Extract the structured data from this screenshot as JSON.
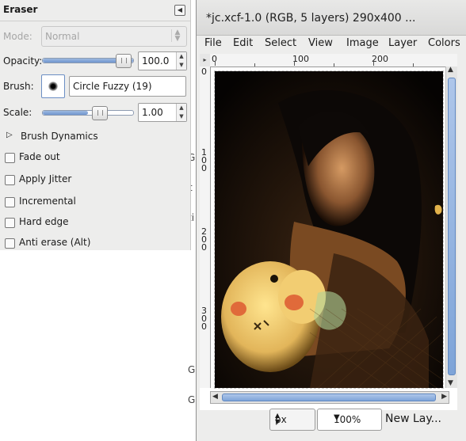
{
  "tool_options": {
    "title": "Eraser",
    "mode": {
      "label": "Mode:",
      "value": "Normal"
    },
    "opacity": {
      "label": "Opacity:",
      "value": "100.0",
      "fraction": 1.0
    },
    "brush": {
      "label": "Brush:",
      "name": "Circle Fuzzy (19)"
    },
    "scale": {
      "label": "Scale:",
      "value": "1.00",
      "fraction": 0.5
    },
    "brush_dynamics": "Brush Dynamics",
    "options": [
      {
        "label": "Fade out",
        "checked": false
      },
      {
        "label": "Apply Jitter",
        "checked": false
      },
      {
        "label": "Incremental",
        "checked": false
      },
      {
        "label": "Hard edge",
        "checked": false
      },
      {
        "label": "Anti erase  (Alt)",
        "checked": false
      }
    ]
  },
  "image_window": {
    "title": "*jc.xcf-1.0 (RGB, 5 layers) 290x400 ...",
    "menu": [
      "File",
      "Edit",
      "Select",
      "View",
      "Image",
      "Layer",
      "Colors"
    ],
    "ruler_top": [
      "0",
      "100",
      "200"
    ],
    "ruler_left": [
      "0",
      "1\n0\n0",
      "2\n0\n0",
      "3\n0\n0"
    ],
    "unit": "px",
    "zoom": "100%",
    "status": "New Lay..."
  },
  "background_fragments": [
    "G",
    "t",
    "ti",
    "G",
    "G"
  ]
}
